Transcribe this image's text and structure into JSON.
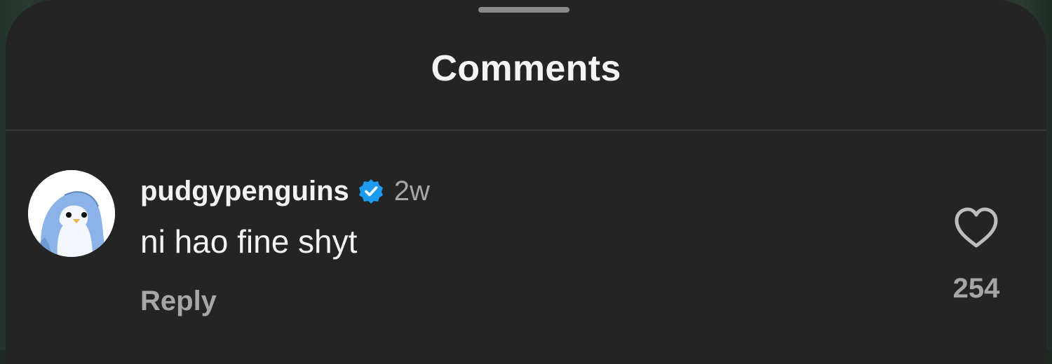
{
  "sheet": {
    "title": "Comments"
  },
  "comment": {
    "username": "pudgypenguins",
    "verified": true,
    "timestamp": "2w",
    "text": "ni hao fine shyt",
    "reply_label": "Reply",
    "like_count": "254",
    "avatar_icon": "penguin-avatar-icon",
    "like_icon": "heart-outline-icon",
    "verified_icon": "verified-badge-icon"
  },
  "colors": {
    "background": "#242424",
    "text_primary": "#f2f2f2",
    "text_secondary": "#a6a6a6",
    "verified_blue": "#1d9bf0",
    "divider": "#363636"
  }
}
